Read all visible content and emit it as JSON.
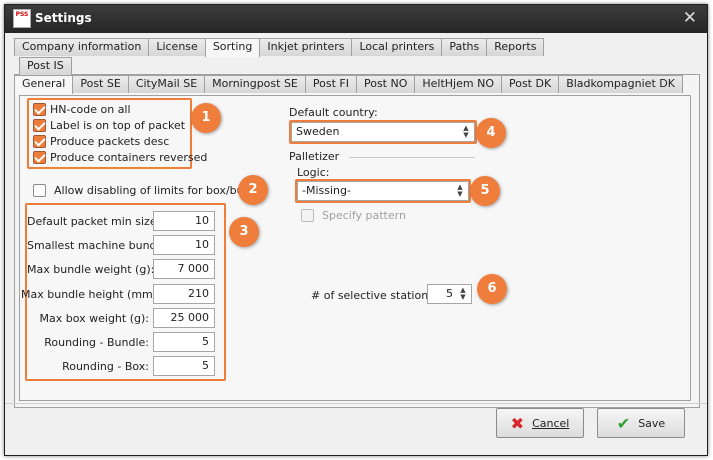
{
  "window": {
    "title": "Settings",
    "app_icon_text": "PSS",
    "close_glyph": "✕"
  },
  "top_tabs": [
    {
      "label": "Company information"
    },
    {
      "label": "License"
    },
    {
      "label": "Sorting"
    },
    {
      "label": "Inkjet printers"
    },
    {
      "label": "Local printers"
    },
    {
      "label": "Paths"
    },
    {
      "label": "Reports"
    }
  ],
  "sub_tabs_row1": [
    {
      "label": "Post IS"
    }
  ],
  "sub_tabs_row2": [
    {
      "label": "General"
    },
    {
      "label": "Post SE"
    },
    {
      "label": "CityMail SE"
    },
    {
      "label": "Morningpost SE"
    },
    {
      "label": "Post FI"
    },
    {
      "label": "Post NO"
    },
    {
      "label": "HeltHjem NO"
    },
    {
      "label": "Post DK"
    },
    {
      "label": "Bladkompagniet DK"
    }
  ],
  "checkbox_group": {
    "items": [
      {
        "label": "HN-code on all",
        "checked": true
      },
      {
        "label": "Label is on top of packet",
        "checked": true
      },
      {
        "label": "Produce packets desc",
        "checked": true
      },
      {
        "label": "Produce containers reversed",
        "checked": true
      }
    ]
  },
  "allow_disabling": {
    "label": "Allow disabling of limits for box/bundle",
    "checked": false
  },
  "limits": [
    {
      "label": "Default packet min size:",
      "value": "10"
    },
    {
      "label": "Smallest machine bundle:",
      "value": "10"
    },
    {
      "label": "Max bundle weight (g):",
      "value": "7 000"
    },
    {
      "label": "Max bundle height (mm):",
      "value": "210"
    },
    {
      "label": "Max box weight (g):",
      "value": "25 000"
    },
    {
      "label": "Rounding - Bundle:",
      "value": "5"
    },
    {
      "label": "Rounding - Box:",
      "value": "5"
    }
  ],
  "country": {
    "label": "Default country:",
    "value": "Sweden"
  },
  "palletizer": {
    "group_label": "Palletizer",
    "logic_label": "Logic:",
    "logic_value": "-Missing-",
    "specify_pattern_label": "Specify pattern",
    "specify_pattern_checked": false
  },
  "stations": {
    "label": "# of selective stations:",
    "value": "5"
  },
  "badges": [
    "1",
    "2",
    "3",
    "4",
    "5",
    "6"
  ],
  "buttons": {
    "cancel": {
      "label": "Cancel",
      "icon": "✖"
    },
    "save": {
      "label": "Save",
      "icon": "✔"
    }
  },
  "colors": {
    "highlight": "#ef7d3c",
    "cancel_icon": "#d9262a",
    "save_icon": "#2fa32f",
    "titlebar": "#2f2f2f"
  }
}
